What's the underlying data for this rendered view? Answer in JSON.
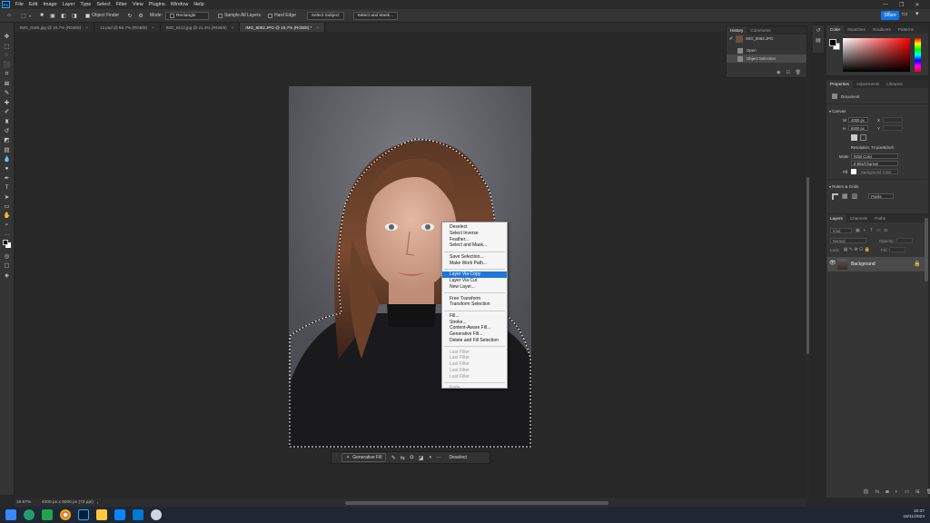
{
  "menubar": {
    "app_logo": "Ps",
    "items": [
      "File",
      "Edit",
      "Image",
      "Layer",
      "Type",
      "Select",
      "Filter",
      "View",
      "Plugins",
      "Window",
      "Help"
    ],
    "window_controls": [
      "—",
      "❐",
      "✕"
    ]
  },
  "options": {
    "object_finder": "Object Finder",
    "mode_label": "Mode:",
    "mode_value": "Rectangle",
    "sample_all_layers": "Sample All Layers",
    "hard_edge": "Hard Edge",
    "select_subject": "Select Subject",
    "select_and_mask": "Select and Mask...",
    "share": "Share"
  },
  "tabs": [
    {
      "label": "IMG_8165.jpg @ 16.7% (RGB/8)",
      "active": false
    },
    {
      "label": "12.psd @ 66.7% (RGB/8)",
      "active": false
    },
    {
      "label": "IMG_8112.jpg @ 21.4% (RGB/8)",
      "active": false
    },
    {
      "label": "IMG_8082.JPG @ 16.7% (RGB/8) *",
      "active": true
    }
  ],
  "context_menu": {
    "groups": [
      [
        {
          "label": "Deselect"
        },
        {
          "label": "Select Inverse"
        },
        {
          "label": "Feather..."
        },
        {
          "label": "Select and Mask..."
        }
      ],
      [
        {
          "label": "Save Selection..."
        },
        {
          "label": "Make Work Path..."
        }
      ],
      [
        {
          "label": "Layer Via Copy",
          "highlighted": true
        },
        {
          "label": "Layer Via Cut"
        },
        {
          "label": "New Layer..."
        }
      ],
      [
        {
          "label": "Free Transform"
        },
        {
          "label": "Transform Selection"
        }
      ],
      [
        {
          "label": "Fill..."
        },
        {
          "label": "Stroke..."
        },
        {
          "label": "Content-Aware Fill..."
        },
        {
          "label": "Generative Fill..."
        },
        {
          "label": "Delete and Fill Selection"
        }
      ],
      [
        {
          "label": "Last Filter",
          "disabled": true
        },
        {
          "label": "Last Filter",
          "disabled": true
        },
        {
          "label": "Last Filter",
          "disabled": true
        },
        {
          "label": "Last Filter",
          "disabled": true
        },
        {
          "label": "Last Filter",
          "disabled": true
        }
      ],
      [
        {
          "label": "Fade...",
          "disabled": true
        }
      ]
    ]
  },
  "contextual_taskbar": {
    "generative_fill": "Generative Fill",
    "deselect": "Deselect",
    "more": "···"
  },
  "status": {
    "zoom": "16.67%",
    "doc_size": "4000 px x 6000 px (72 ppi)"
  },
  "history": {
    "tabs": [
      "History",
      "Comments"
    ],
    "snapshot": "IMG_8082.JPG",
    "steps": [
      "Open",
      "Object Selection"
    ]
  },
  "color_panel": {
    "tabs": [
      "Color",
      "Swatches",
      "Gradients",
      "Patterns"
    ],
    "foreground": "#000000",
    "background": "#ffffff"
  },
  "properties": {
    "tabs": [
      "Properties",
      "Adjustments",
      "Libraries"
    ],
    "document_label": "Document",
    "canvas_label": "Canvas",
    "width_label": "W",
    "width_value": "4000 px",
    "height_label": "H",
    "height_value": "6000 px",
    "x_label": "X",
    "y_label": "Y",
    "resolution": "Resolution: 72 pixels/inch",
    "mode_label": "Mode",
    "mode_value": "RGB Color",
    "bit_depth": "8 Bits/Channel",
    "fill_label": "Fill",
    "fill_value": "Background Color",
    "rulers_label": "Rulers & Grids",
    "rulers_unit": "Pixels"
  },
  "layers": {
    "tabs": [
      "Layers",
      "Channels",
      "Paths"
    ],
    "kind_label": "Kind",
    "blend_mode": "Normal",
    "opacity_label": "Opacity:",
    "lock_label": "Lock:",
    "fill_label": "Fill:",
    "layer_name": "Background"
  },
  "clock": {
    "time": "10:37",
    "date": "18/11/2024"
  }
}
